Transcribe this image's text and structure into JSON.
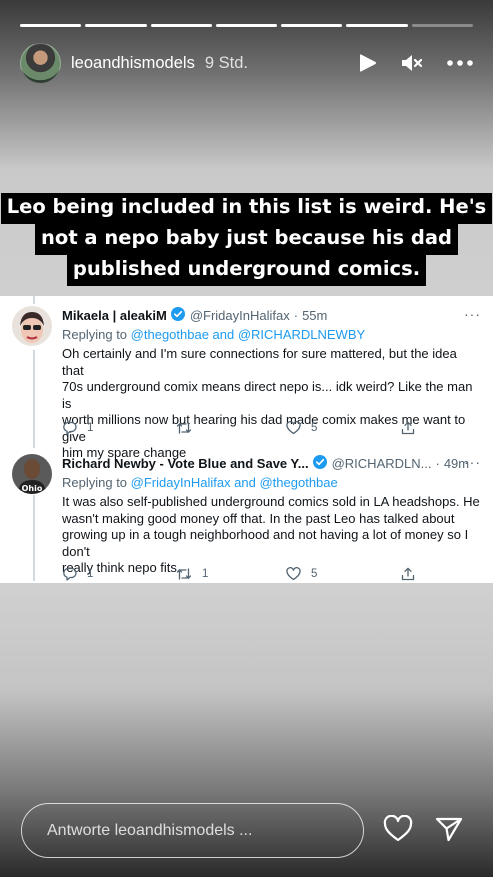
{
  "story": {
    "progress_segments": [
      1,
      1,
      1,
      1,
      1,
      1,
      0
    ],
    "username": "leoandhismodels",
    "time": "9 Std.",
    "icons": {
      "play": "play-icon",
      "mute": "speaker-muted-icon",
      "more": "more-icon"
    }
  },
  "caption": {
    "lines": [
      "Leo being included in this list is weird. He's",
      "not a nepo baby just because his dad",
      "published underground comics."
    ]
  },
  "tweets": [
    {
      "name": "Mikaela | aleakiM",
      "handle": "@FridayInHalifax",
      "dot": "·",
      "age": "55m",
      "more": "···",
      "reply_prefix": "Replying to",
      "reply_mentions": "@thegothbae and @RICHARDLNEWBY",
      "text_lines": [
        "Oh certainly and I'm sure connections for sure mattered, but the idea that",
        "70s underground comix means direct nepo is... idk weird? Like the man is",
        "worth millions now but hearing his dad made comix makes me want to give",
        "him my spare change"
      ],
      "replies": "1",
      "retweets": "",
      "likes": "5"
    },
    {
      "name": "Richard Newby - Vote Blue and Save Y...",
      "handle": "@RICHARDLN...",
      "dot": "·",
      "age": "49m",
      "more": "···",
      "reply_prefix": "Replying to",
      "reply_mentions": "@FridayInHalifax and @thegothbae",
      "text_lines": [
        "It was also self-published underground comics sold in LA headshops. He",
        "wasn't making good money off that. In the past Leo has talked about",
        "growing up in a tough neighborhood and not having a lot of money so I don't",
        "really think nepo fits."
      ],
      "replies": "1",
      "retweets": "1",
      "likes": "5"
    }
  ],
  "avatar_text": {
    "ohio": "Ohio"
  },
  "reply_bar": {
    "placeholder": "Antworte leoandhismodels ..."
  },
  "colors": {
    "twitter_blue": "#1d9bf0",
    "text": "#0f1419",
    "muted": "#536471"
  }
}
